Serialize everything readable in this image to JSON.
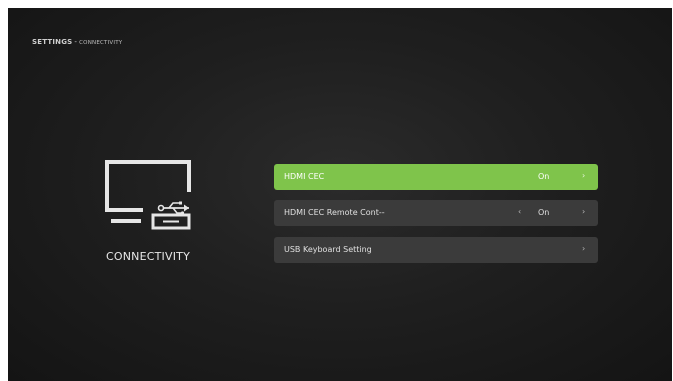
{
  "breadcrumb": {
    "title": "SETTINGS",
    "separator": "-",
    "sub": "CONNECTIVITY"
  },
  "category": {
    "label": "CONNECTIVITY",
    "icon": "monitor-usb-icon"
  },
  "menu": {
    "items": [
      {
        "label": "HDMI CEC",
        "value": "On",
        "left_arrow": "",
        "right_arrow": "›"
      },
      {
        "label": "HDMI CEC Remote Cont--",
        "value": "On",
        "left_arrow": "‹",
        "right_arrow": "›"
      },
      {
        "label": "USB Keyboard Setting",
        "value": "",
        "left_arrow": "",
        "right_arrow": "›"
      }
    ]
  },
  "colors": {
    "accent": "#7fc44b",
    "background": "#1f1f1f",
    "row": "#3b3b3b"
  }
}
